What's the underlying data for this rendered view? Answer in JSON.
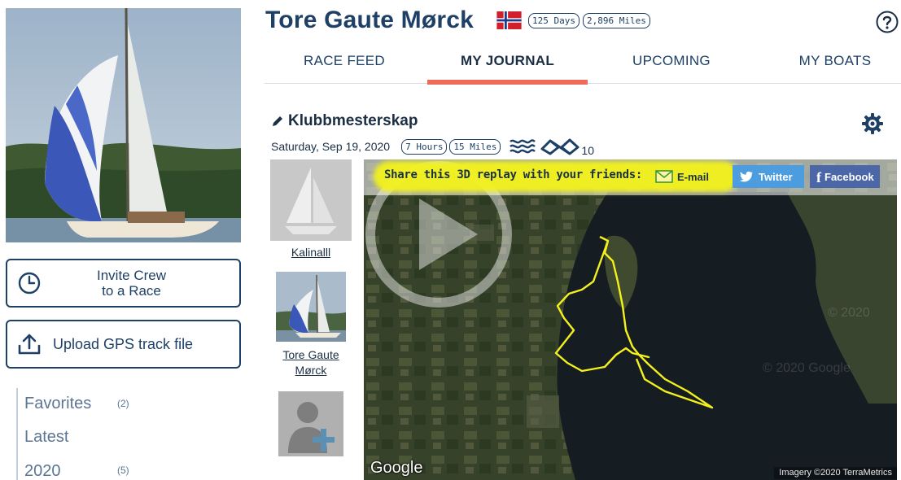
{
  "profile": {
    "name": "Tore Gaute Mørck",
    "days_pill": "125 Days",
    "miles_pill": "2,896 Miles",
    "country_flag": "norway-flag-icon"
  },
  "sidebar": {
    "invite_label_line1": "Invite Crew",
    "invite_label_line2": "to a Race",
    "upload_label": "Upload GPS track file",
    "filters": [
      {
        "name": "Favorites",
        "count": "(2)"
      },
      {
        "name": "Latest",
        "count": ""
      },
      {
        "name": "2020",
        "count": "(5)"
      }
    ]
  },
  "tabs": [
    {
      "label": "RACE FEED",
      "active": false
    },
    {
      "label": "MY JOURNAL",
      "active": true
    },
    {
      "label": "UPCOMING",
      "active": false
    },
    {
      "label": "MY BOATS",
      "active": false
    }
  ],
  "entry": {
    "title": "Klubbmesterskap",
    "date": "Saturday, Sep 19, 2020",
    "hours_pill": "7 Hours",
    "miles_pill": "15 Miles",
    "flag_count": "10"
  },
  "crew": {
    "boat_name": "Kalinalll",
    "user_name_line1": "Tore Gaute",
    "user_name_line2": "Mørck"
  },
  "share": {
    "prompt": "Share this 3D replay with your friends:",
    "email_label": "E-mail",
    "twitter_label": "Twitter",
    "facebook_label": "Facebook"
  },
  "map": {
    "google_label": "Google",
    "imagery_credit": "Imagery ©2020 TerraMetrics",
    "watermark_1": "© 2020",
    "watermark_2": "© 2020 Google",
    "track_color": "#f4f01e"
  },
  "colors": {
    "brand_navy": "#1e3f66",
    "tab_accent": "#ef6a58",
    "share_highlight": "#f3f21c",
    "twitter_blue": "#4b9de0",
    "facebook_blue": "#4b67a8"
  }
}
